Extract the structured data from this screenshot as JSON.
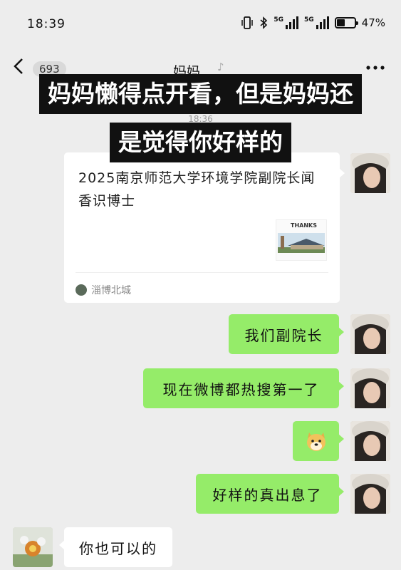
{
  "status_bar": {
    "time": "18:39",
    "network_1": "5G",
    "network_2": "5G",
    "battery_percent": "47%"
  },
  "nav": {
    "back_icon": "chevron-left-icon",
    "unread_count": "693",
    "title": "妈妈",
    "more_icon": "more-dots-icon"
  },
  "caption": {
    "line1": "妈妈懒得点开看，但是妈妈还",
    "line2": "是觉得你好样的"
  },
  "timestamp": "18:36",
  "messages": {
    "card": {
      "title": "2025南京师范大学环境学院副院长闻香识博士",
      "thumb_text": "THANKS",
      "source": "淄博北城"
    },
    "m1": "我们副院长",
    "m2": "现在微博都热搜第一了",
    "m3_emoji": "doge-emoji",
    "m4": "好样的真出息了",
    "reply": "你也可以的"
  },
  "colors": {
    "bubble_me": "#95ec69",
    "bubble_other": "#ffffff",
    "background": "#ededed",
    "caption_bg": "#111111"
  }
}
